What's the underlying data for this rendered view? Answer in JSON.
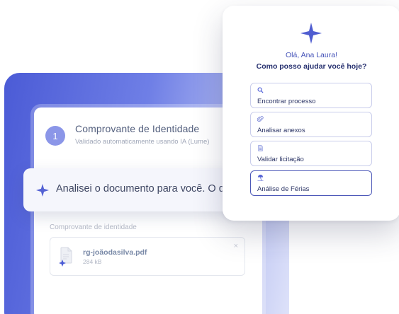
{
  "document": {
    "step_number": "1",
    "title": "Comprovante de Identidade",
    "subtitle": "Validado automaticamente usando IA (Lume)",
    "section_label": "Comprovante de identidade",
    "file": {
      "name": "rg-joãodasilva.pdf",
      "size": "284 kB",
      "close_glyph": "×"
    }
  },
  "ai_banner": {
    "message": "Analisei o documento para você. O que"
  },
  "chat": {
    "greeting": "Olá, Ana Laura!",
    "question": "Como posso ajudar você hoje?",
    "options": [
      {
        "label": "Encontrar processo",
        "icon": "search-icon"
      },
      {
        "label": "Analisar anexos",
        "icon": "paperclip-icon"
      },
      {
        "label": "Validar licitação",
        "icon": "document-icon"
      },
      {
        "label": "Análise de Férias",
        "icon": "beach-icon"
      }
    ]
  },
  "colors": {
    "brand_blue": "#4b5bd6",
    "accent_indigo": "#4c58b8",
    "sparkle": "#5563d4"
  }
}
